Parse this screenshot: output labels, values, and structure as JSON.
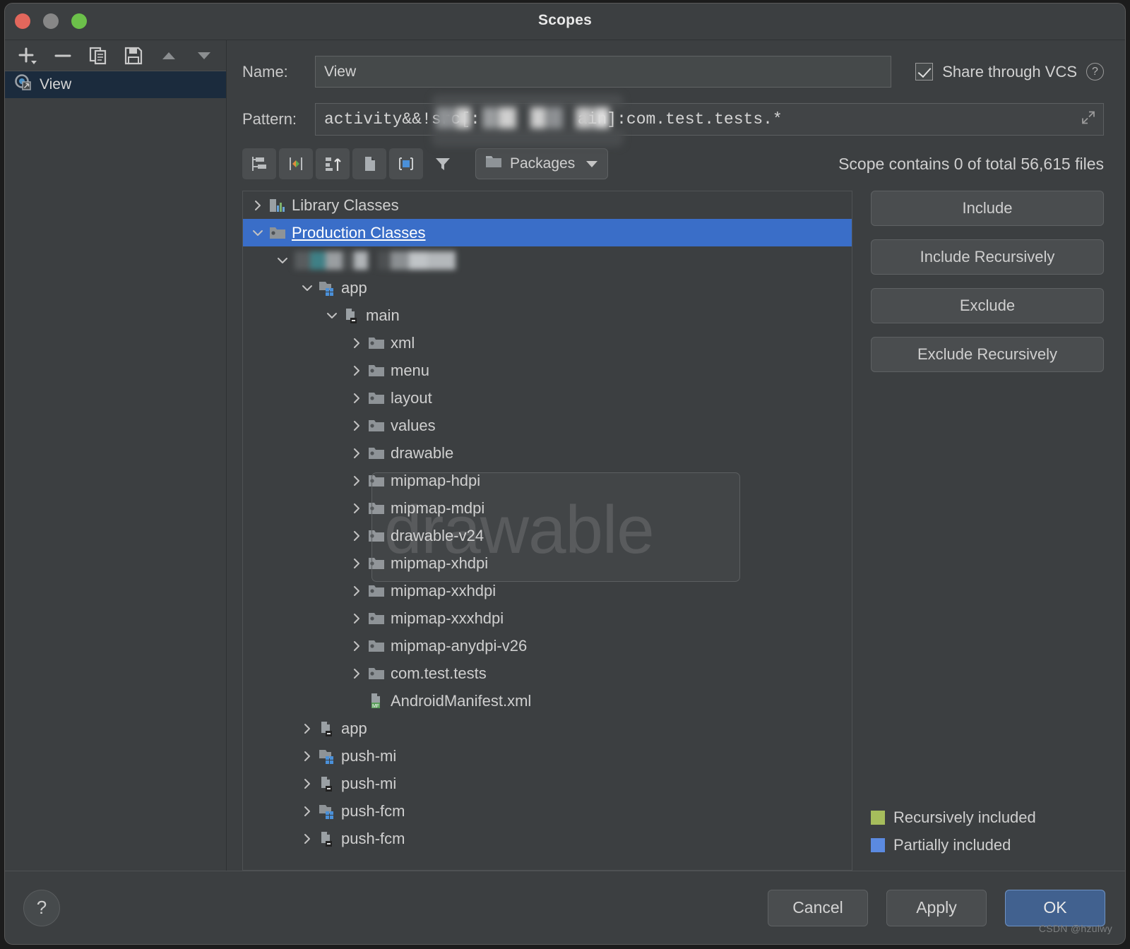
{
  "window": {
    "title": "Scopes",
    "traffic": {
      "close": "close-button",
      "minimize": "minimize-button",
      "zoom": "zoom-button"
    }
  },
  "sidebar": {
    "toolbar": [
      {
        "name": "add-scope-button",
        "icon": "plus-icon"
      },
      {
        "name": "remove-scope-button",
        "icon": "minus-icon"
      },
      {
        "name": "copy-scope-button",
        "icon": "copy-icon"
      },
      {
        "name": "save-scope-button",
        "icon": "save-icon"
      },
      {
        "name": "move-up-button",
        "icon": "triangle-up-icon"
      },
      {
        "name": "move-down-button",
        "icon": "triangle-down-icon"
      }
    ],
    "items": [
      {
        "label": "View",
        "icon": "scope-shared-icon",
        "selected": true
      }
    ]
  },
  "form": {
    "name_label": "Name:",
    "name_value": "View",
    "share_label": "Share through VCS",
    "share_checked": true,
    "help_icon_label": "?",
    "pattern_label": "Pattern:",
    "pattern_value_prefix": "activity&&!src[:",
    "pattern_value_suffix": "ain]:com.test.tests.*",
    "pattern_full": "activity&&!src[:█████ain]:com.test.tests.*"
  },
  "toolbar": {
    "buttons": [
      {
        "name": "flatten-packages-button",
        "icon": "flatten-packages-icon"
      },
      {
        "name": "compact-middle-packages-button",
        "icon": "compact-packages-icon"
      },
      {
        "name": "sort-by-type-button",
        "icon": "sort-by-type-icon"
      },
      {
        "name": "show-files-button",
        "icon": "file-icon"
      },
      {
        "name": "show-modules-button",
        "icon": "module-icon"
      },
      {
        "name": "filter-button",
        "icon": "funnel-icon"
      }
    ],
    "grouping_label": "Packages",
    "grouping_icon": "folder-icon",
    "scope_count_text": "Scope contains 0 of total 56,615 files"
  },
  "tree": {
    "rows": [
      {
        "label": "Library Classes",
        "indent": 0,
        "arrow": "right",
        "icon": "library-icon",
        "selected": false
      },
      {
        "label": "Production Classes",
        "indent": 0,
        "arrow": "down",
        "icon": "folder-icon",
        "selected": true
      },
      {
        "label": "",
        "indent": 1,
        "arrow": "down",
        "icon": "redacted",
        "selected": false,
        "redacted": true
      },
      {
        "label": "app",
        "indent": 2,
        "arrow": "down",
        "icon": "module-icon",
        "selected": false
      },
      {
        "label": "main",
        "indent": 3,
        "arrow": "down",
        "icon": "source-root-icon",
        "selected": false
      },
      {
        "label": "xml",
        "indent": 4,
        "arrow": "right",
        "icon": "folder-icon",
        "selected": false
      },
      {
        "label": "menu",
        "indent": 4,
        "arrow": "right",
        "icon": "folder-icon",
        "selected": false
      },
      {
        "label": "layout",
        "indent": 4,
        "arrow": "right",
        "icon": "folder-icon",
        "selected": false
      },
      {
        "label": "values",
        "indent": 4,
        "arrow": "right",
        "icon": "folder-icon",
        "selected": false
      },
      {
        "label": "drawable",
        "indent": 4,
        "arrow": "right",
        "icon": "folder-icon",
        "selected": false
      },
      {
        "label": "mipmap-hdpi",
        "indent": 4,
        "arrow": "right",
        "icon": "folder-icon",
        "selected": false
      },
      {
        "label": "mipmap-mdpi",
        "indent": 4,
        "arrow": "right",
        "icon": "folder-icon",
        "selected": false
      },
      {
        "label": "drawable-v24",
        "indent": 4,
        "arrow": "right",
        "icon": "folder-icon",
        "selected": false
      },
      {
        "label": "mipmap-xhdpi",
        "indent": 4,
        "arrow": "right",
        "icon": "folder-icon",
        "selected": false
      },
      {
        "label": "mipmap-xxhdpi",
        "indent": 4,
        "arrow": "right",
        "icon": "folder-icon",
        "selected": false
      },
      {
        "label": "mipmap-xxxhdpi",
        "indent": 4,
        "arrow": "right",
        "icon": "folder-icon",
        "selected": false
      },
      {
        "label": "mipmap-anydpi-v26",
        "indent": 4,
        "arrow": "right",
        "icon": "folder-icon",
        "selected": false
      },
      {
        "label": "com.test.tests",
        "indent": 4,
        "arrow": "right",
        "icon": "folder-icon",
        "selected": false
      },
      {
        "label": "AndroidManifest.xml",
        "indent": 4,
        "arrow": "none",
        "icon": "manifest-icon",
        "selected": false
      },
      {
        "label": "app",
        "indent": 2,
        "arrow": "right",
        "icon": "source-root-icon",
        "selected": false
      },
      {
        "label": "push-mi",
        "indent": 2,
        "arrow": "right",
        "icon": "module-icon",
        "selected": false
      },
      {
        "label": "push-mi",
        "indent": 2,
        "arrow": "right",
        "icon": "source-root-icon",
        "selected": false
      },
      {
        "label": "push-fcm",
        "indent": 2,
        "arrow": "right",
        "icon": "module-icon",
        "selected": false
      },
      {
        "label": "push-fcm",
        "indent": 2,
        "arrow": "right",
        "icon": "source-root-icon",
        "selected": false
      }
    ],
    "overlay_watermark": "drawable"
  },
  "actions": {
    "buttons": [
      {
        "label": "Include",
        "name": "include-button"
      },
      {
        "label": "Include Recursively",
        "name": "include-recursively-button"
      },
      {
        "label": "Exclude",
        "name": "exclude-button"
      },
      {
        "label": "Exclude Recursively",
        "name": "exclude-recursively-button"
      }
    ]
  },
  "legend": {
    "items": [
      {
        "label": "Recursively included",
        "color": "#a6bd5c"
      },
      {
        "label": "Partially included",
        "color": "#5b8ae0"
      }
    ]
  },
  "footer": {
    "help_label": "?",
    "cancel_label": "Cancel",
    "apply_label": "Apply",
    "ok_label": "OK"
  },
  "watermark": "CSDN @hzulwy",
  "colors": {
    "window_bg": "#3c3f41",
    "selection_blue": "#3a6ec8",
    "sidebar_selection": "#1b2b3d",
    "primary_button": "#41618f",
    "recursively_included": "#a6bd5c",
    "partially_included": "#5b8ae0"
  }
}
